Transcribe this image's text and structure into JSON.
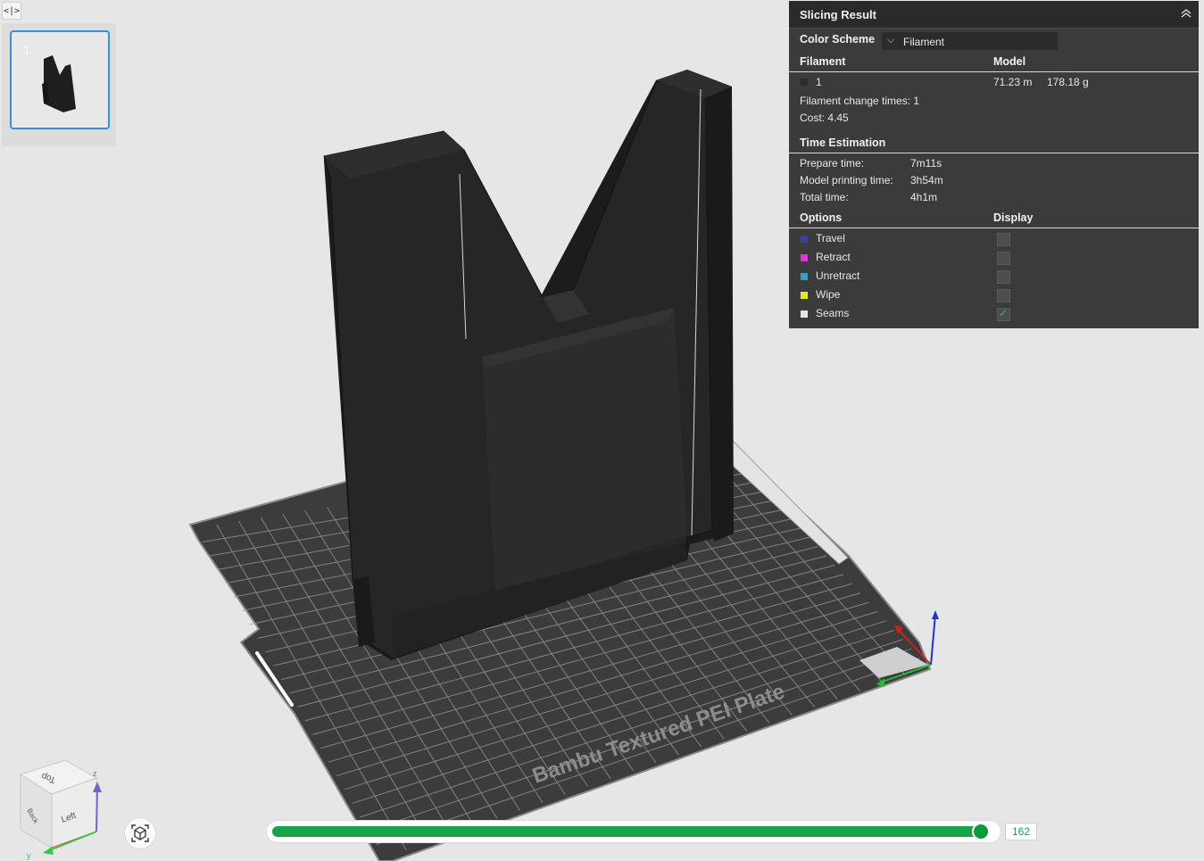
{
  "plates": [
    {
      "label": "1"
    }
  ],
  "panel": {
    "title": "Slicing Result",
    "color_scheme_label": "Color Scheme",
    "color_scheme_value": "Filament",
    "filament_header": "Filament",
    "model_header": "Model",
    "filament_row": {
      "id": "1",
      "length": "71.23 m",
      "weight": "178.18 g",
      "color": "#2b2b2b"
    },
    "filament_change_times": "Filament change times:  1",
    "cost": "Cost:  4.45",
    "time_header": "Time Estimation",
    "prepare_label": "Prepare time:",
    "prepare_value": "7m11s",
    "model_print_label": "Model printing time:",
    "model_print_value": "3h54m",
    "total_label": "Total time:",
    "total_value": "4h1m",
    "options_header": "Options",
    "display_header": "Display",
    "options": [
      {
        "label": "Travel",
        "color": "#3a3fa0",
        "checked": false
      },
      {
        "label": "Retract",
        "color": "#d63ad6",
        "checked": false
      },
      {
        "label": "Unretract",
        "color": "#3aa0c0",
        "checked": false
      },
      {
        "label": "Wipe",
        "color": "#e8e81a",
        "checked": false
      },
      {
        "label": "Seams",
        "color": "#e6e6e6",
        "checked": true
      }
    ]
  },
  "plate_text": "Bambu Textured PEI Plate",
  "navcube": {
    "top": "Top",
    "left": "Left",
    "back": "Back",
    "z": "z",
    "y": "y"
  },
  "slider": {
    "value": "162",
    "fraction": 0.98
  },
  "colors": {
    "accent": "#16a34a",
    "panel_bg": "#3b3b3b",
    "model": "#2a2a2a"
  }
}
